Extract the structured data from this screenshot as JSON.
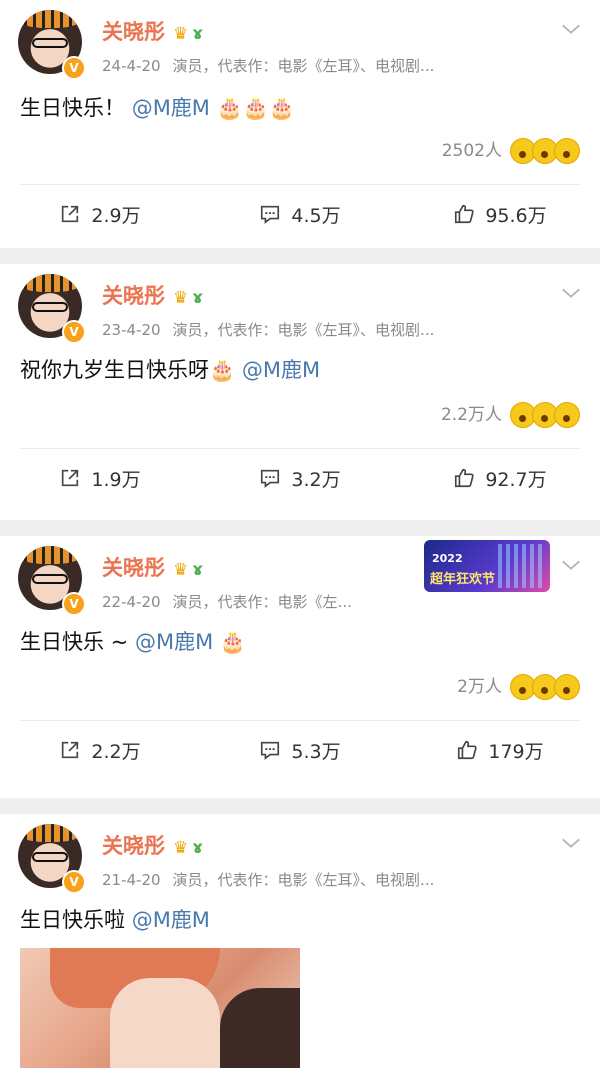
{
  "posts": [
    {
      "user": "关晓彤",
      "date": "24-4-20",
      "bio": "演员，代表作：电影《左耳》、电视剧...",
      "text": "生日快乐！",
      "mention": "@M鹿M",
      "suffix": "🎂🎂🎂",
      "reactions": "2502人",
      "repost": "2.9万",
      "comment": "4.5万",
      "like": "95.6万"
    },
    {
      "user": "关晓彤",
      "date": "23-4-20",
      "bio": "演员，代表作：电影《左耳》、电视剧...",
      "text": "祝你九岁生日快乐呀🎂",
      "mention": "@M鹿M",
      "suffix": "",
      "reactions": "2.2万人",
      "repost": "1.9万",
      "comment": "3.2万",
      "like": "92.7万"
    },
    {
      "user": "关晓彤",
      "date": "22-4-20",
      "bio": "演员，代表作：电影《左...",
      "text": "生日快乐 ~",
      "mention": "@M鹿M",
      "suffix": "🎂",
      "reactions": "2万人",
      "repost": "2.2万",
      "comment": "5.3万",
      "like": "179万",
      "promo_year": "2022",
      "promo_text": "超年狂欢节"
    },
    {
      "user": "关晓彤",
      "date": "21-4-20",
      "bio": "演员，代表作：电影《左耳》、电视剧...",
      "text": "生日快乐啦",
      "mention": "@M鹿M",
      "suffix": ""
    }
  ],
  "icons": {
    "verified": "v-badge-icon",
    "crown": "crown-icon",
    "sprout": "sprout-icon",
    "chevron": "chevron-down-icon",
    "repost": "share-icon",
    "comment": "comment-icon",
    "like": "thumbs-up-icon"
  },
  "colors": {
    "username": "#eb7350",
    "mention": "#4a79ad",
    "meta": "#8a8a8a",
    "background": "#efefef"
  }
}
